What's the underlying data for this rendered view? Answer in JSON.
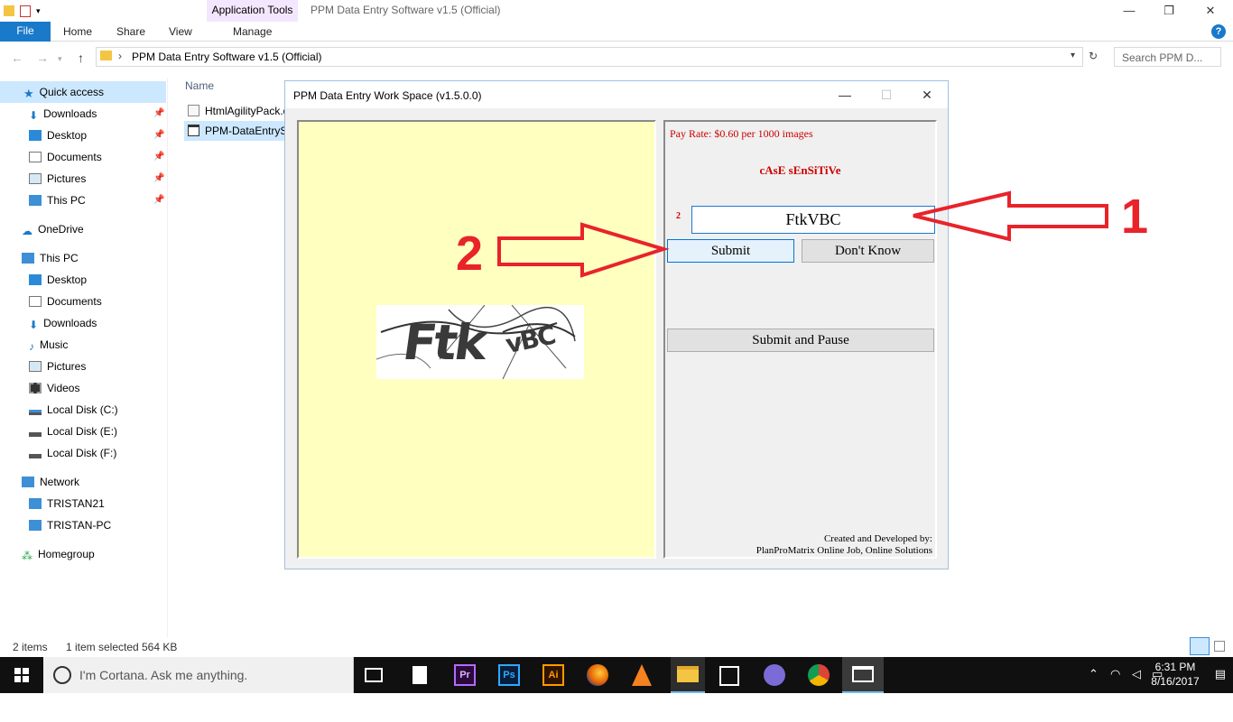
{
  "explorer": {
    "window_title": "PPM Data Entry Software v1.5 (Official)",
    "contextual_tab_group": "Application Tools",
    "ribbon_tabs": [
      "File",
      "Home",
      "Share",
      "View",
      "Manage"
    ],
    "address_path": "PPM Data Entry Software v1.5 (Official)",
    "search_placeholder": "Search PPM D...",
    "column_header": "Name",
    "files": [
      "HtmlAgilityPack.dll",
      "PPM-DataEntrySoftware"
    ],
    "status": {
      "items": "2 items",
      "selected": "1 item selected",
      "size": "564 KB"
    }
  },
  "nav": {
    "quick_access": "Quick access",
    "quick_items": [
      "Downloads",
      "Desktop",
      "Documents",
      "Pictures",
      "This PC"
    ],
    "onedrive": "OneDrive",
    "this_pc": "This PC",
    "pc_items": [
      "Desktop",
      "Documents",
      "Downloads",
      "Music",
      "Pictures",
      "Videos",
      "Local Disk (C:)",
      "Local Disk (E:)",
      "Local Disk (F:)"
    ],
    "network": "Network",
    "network_items": [
      "TRISTAN21",
      "TRISTAN-PC"
    ],
    "homegroup": "Homegroup"
  },
  "ppm": {
    "title": "PPM Data Entry Work Space (v1.5.0.0)",
    "pay_rate": "Pay Rate: $0.60 per 1000 images",
    "case_sensitive": "cAsE sEnSiTiVe",
    "field_marker": "2",
    "answer_value": "FtkVBC",
    "submit": "Submit",
    "dont_know": "Don't Know",
    "submit_pause": "Submit and Pause",
    "credits_line1": "Created and Developed by:",
    "credits_line2": "PlanProMatrix Online Job, Online Solutions",
    "captcha_text": "FtkVBC"
  },
  "annotations": {
    "label_1": "1",
    "label_2": "2",
    "color": "#e8232a"
  },
  "taskbar": {
    "cortana_placeholder": "I'm Cortana. Ask me anything.",
    "time": "6:31 PM",
    "date": "8/16/2017",
    "icons": [
      "task-view-icon",
      "file-icon",
      "premiere-icon",
      "photoshop-icon",
      "illustrator-icon",
      "firefox-icon",
      "vlc-icon",
      "file-explorer-icon",
      "store-icon",
      "bittorrent-icon",
      "chrome-icon",
      "ppm-app-icon"
    ],
    "premiere_label": "Pr",
    "photoshop_label": "Ps",
    "illustrator_label": "Ai"
  },
  "colors": {
    "accent": "#1979ca",
    "red": "#cc0000",
    "panel_yellow": "#ffffc0"
  }
}
